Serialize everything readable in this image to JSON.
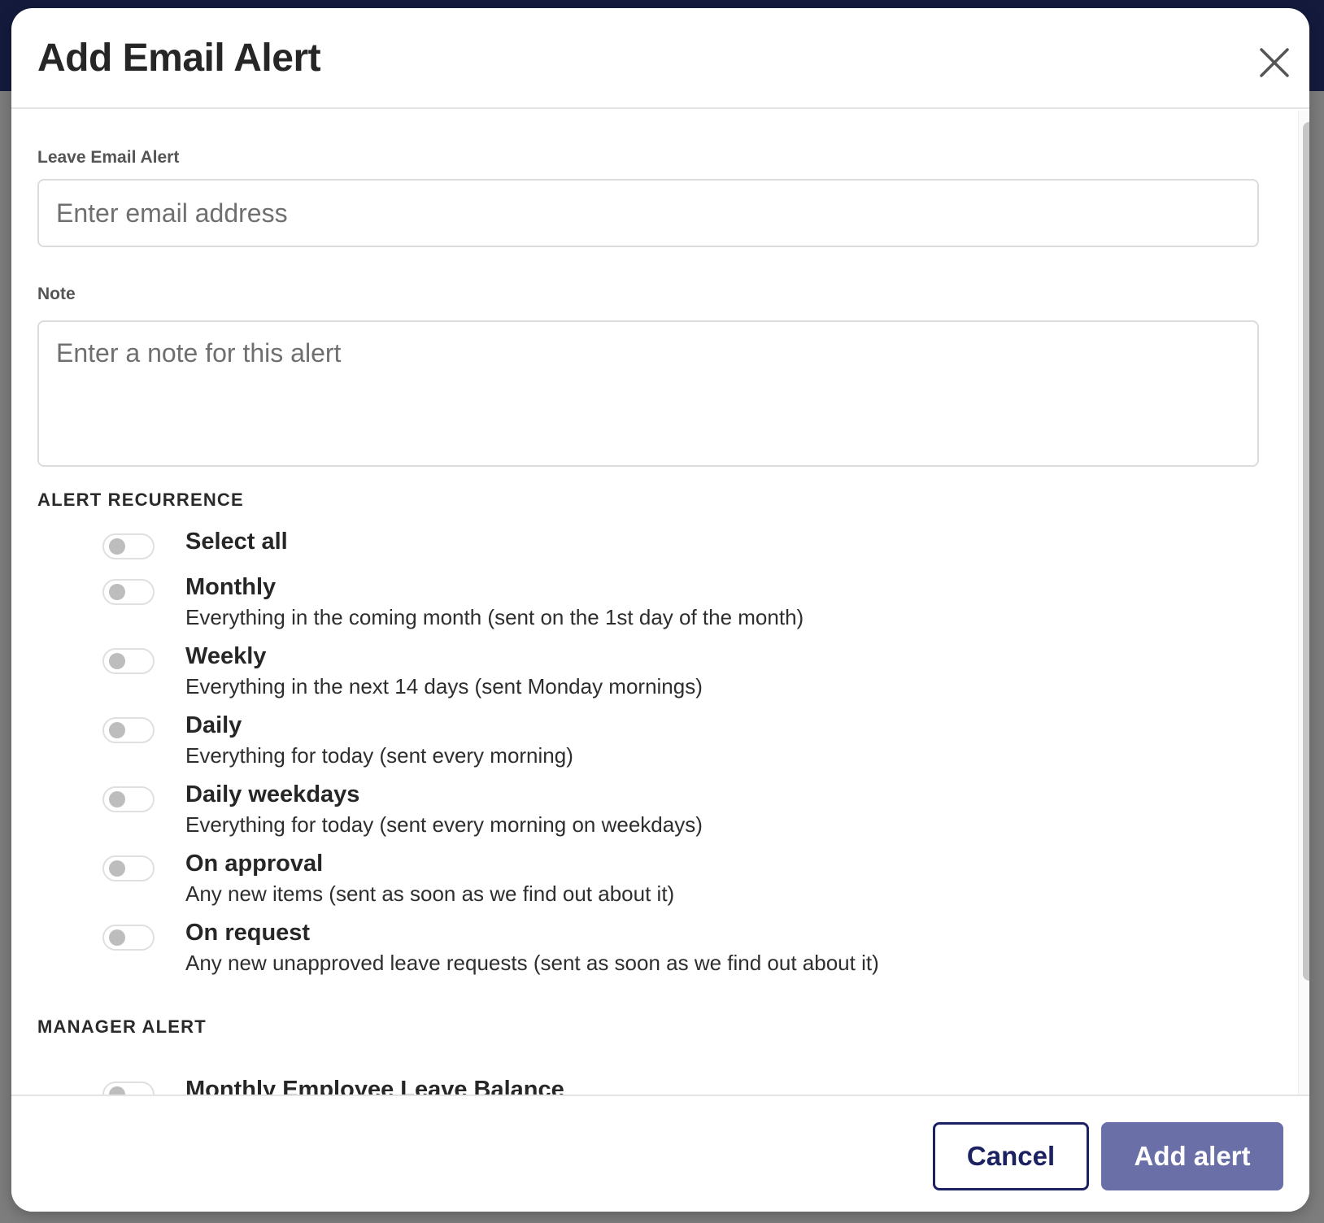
{
  "modal": {
    "title": "Add Email Alert"
  },
  "email_field": {
    "label": "Leave Email Alert",
    "placeholder": "Enter email address",
    "value": ""
  },
  "note_field": {
    "label": "Note",
    "placeholder": "Enter a note for this alert",
    "value": ""
  },
  "recurrence": {
    "heading": "ALERT RECURRENCE",
    "options": [
      {
        "title": "Select all",
        "description": "",
        "enabled": false
      },
      {
        "title": "Monthly",
        "description": "Everything in the coming month (sent on the 1st day of the month)",
        "enabled": false
      },
      {
        "title": "Weekly",
        "description": "Everything in the next 14 days (sent Monday mornings)",
        "enabled": false
      },
      {
        "title": "Daily",
        "description": "Everything for today (sent every morning)",
        "enabled": false
      },
      {
        "title": "Daily weekdays",
        "description": "Everything for today (sent every morning on weekdays)",
        "enabled": false
      },
      {
        "title": "On approval",
        "description": "Any new items (sent as soon as we find out about it)",
        "enabled": false
      },
      {
        "title": "On request",
        "description": "Any new unapproved leave requests (sent as soon as we find out about it)",
        "enabled": false
      }
    ]
  },
  "manager_alert": {
    "heading": "MANAGER ALERT",
    "options": [
      {
        "title": "Monthly Employee Leave Balance",
        "enabled": false
      }
    ]
  },
  "footer": {
    "cancel_label": "Cancel",
    "add_label": "Add alert"
  },
  "icons": {
    "close": "close-icon"
  },
  "colors": {
    "primary": "#1b2161",
    "primary_muted": "#6b6fa8",
    "backdrop": "#7d7d7d",
    "topbar": "#141a3c"
  }
}
